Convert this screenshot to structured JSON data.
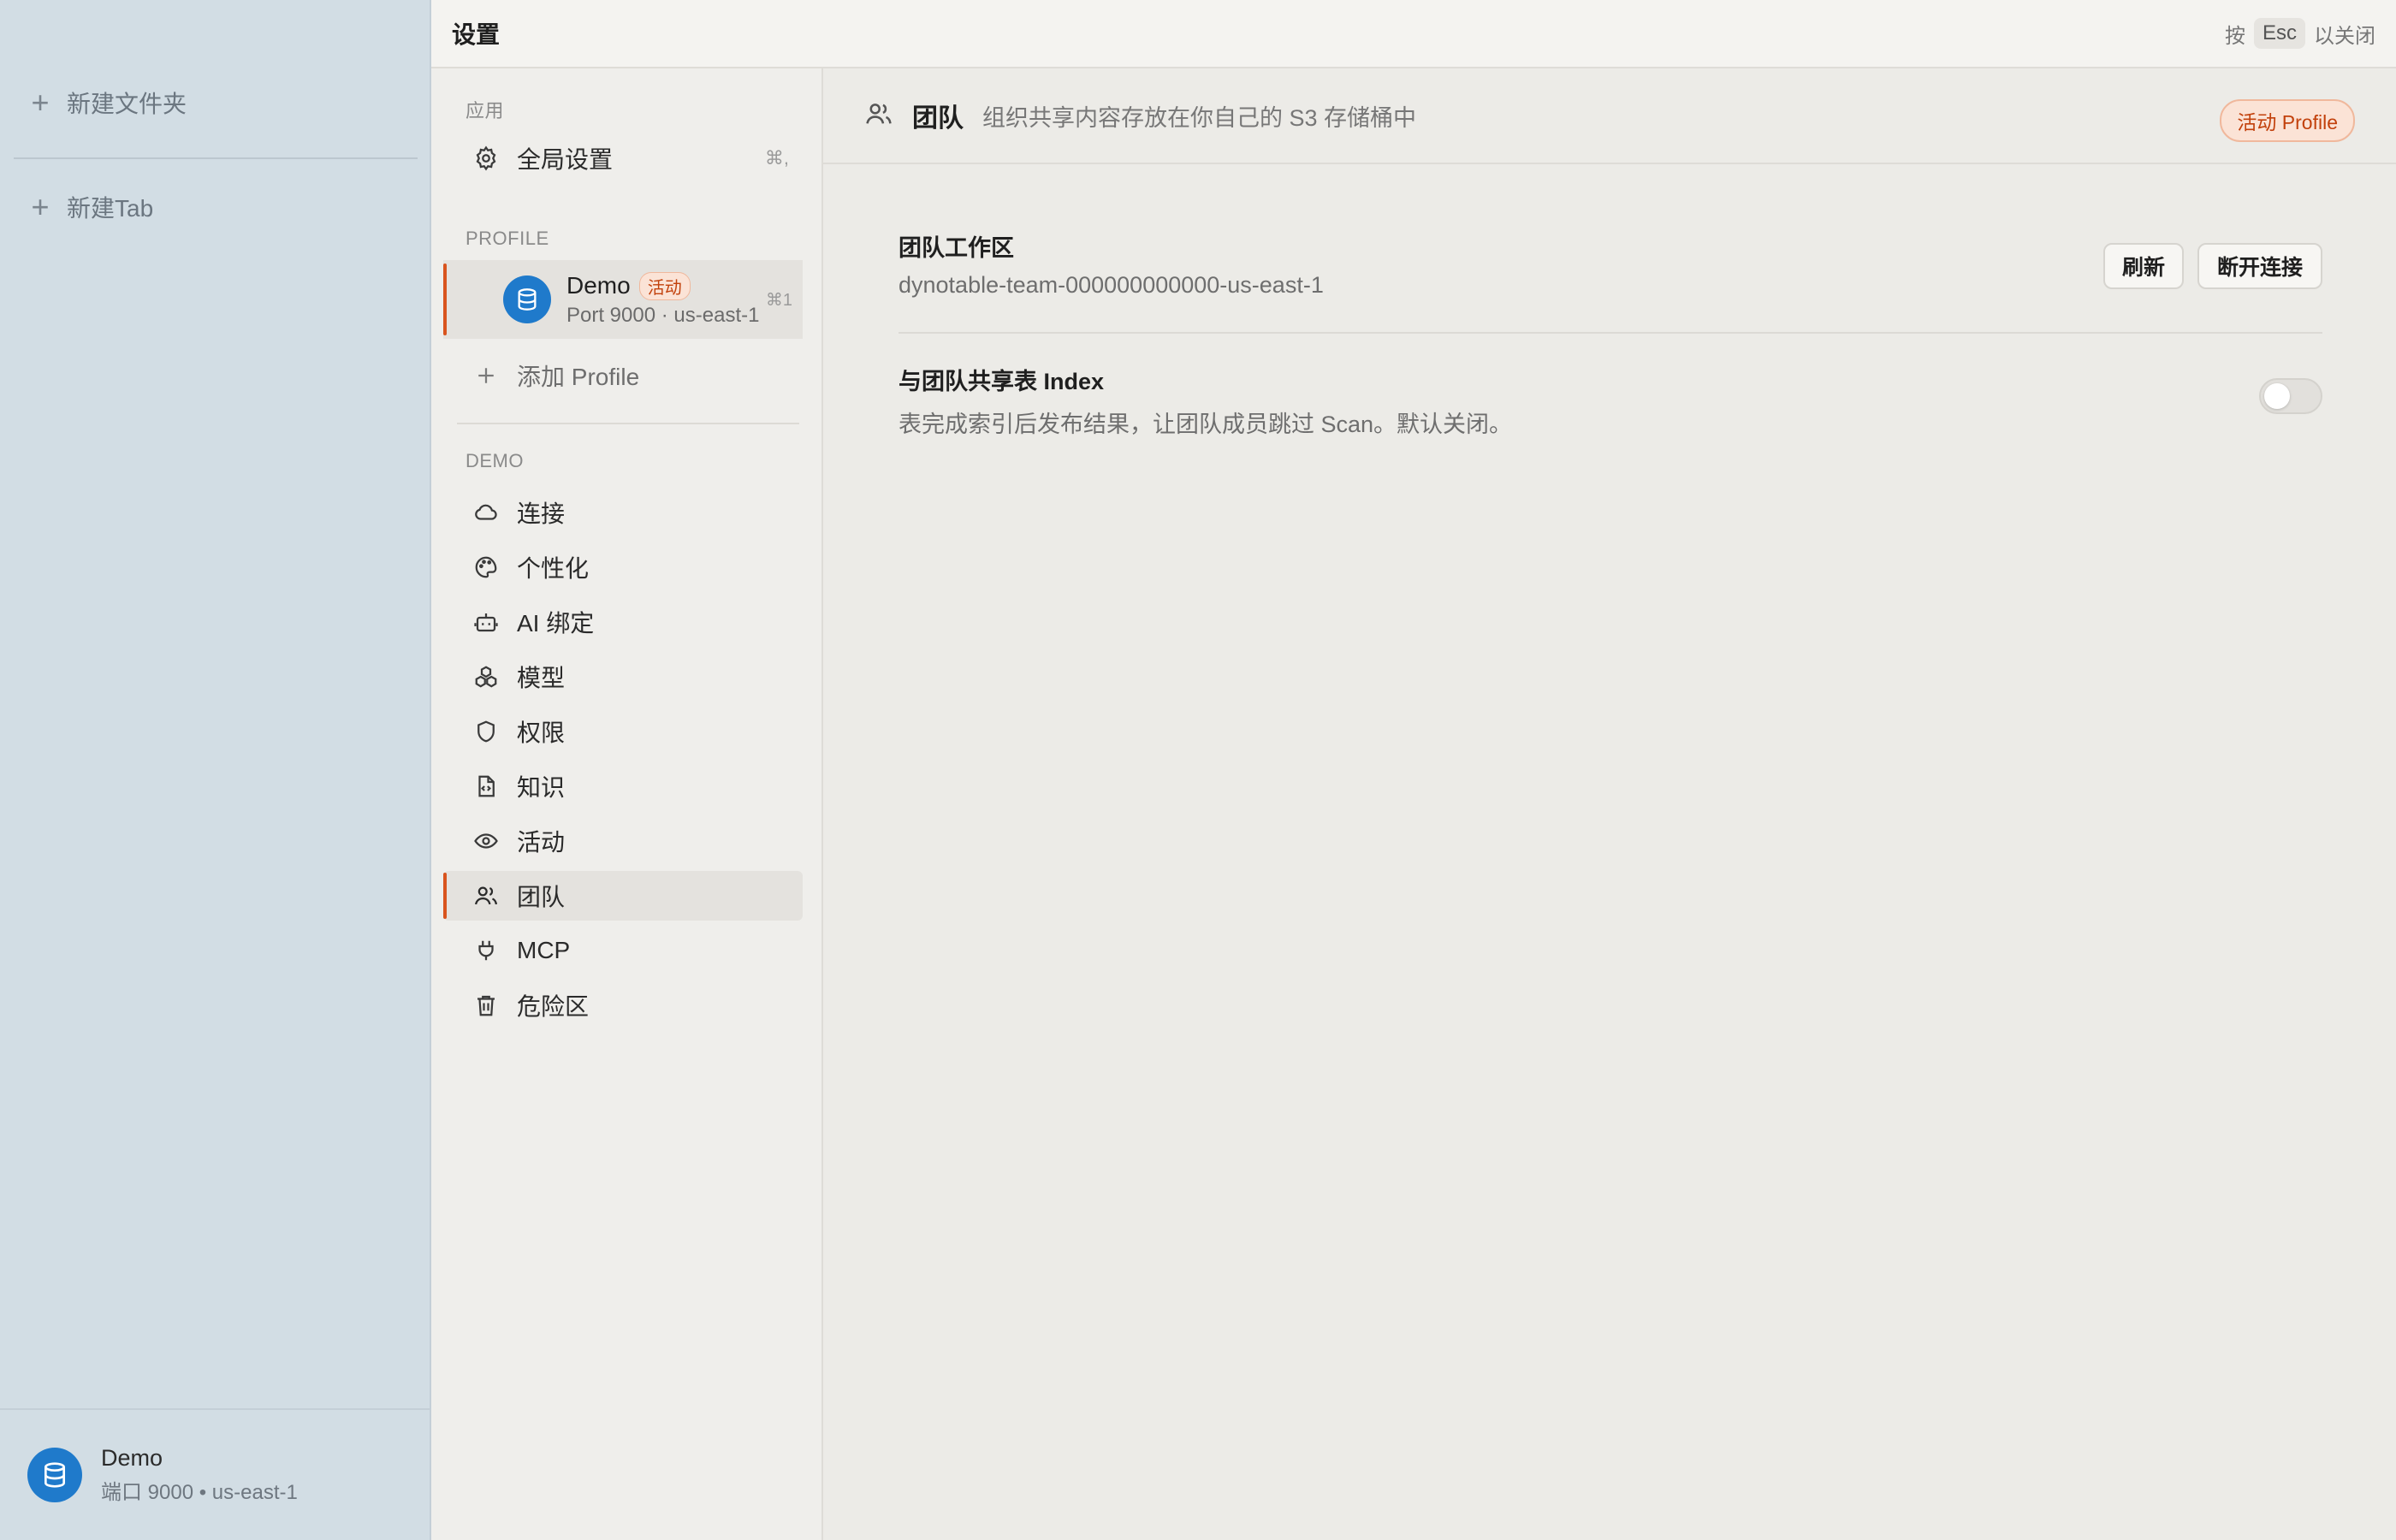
{
  "app_sidebar": {
    "new_folder_label": "新建文件夹",
    "new_tab_label": "新建Tab",
    "footer": {
      "name": "Demo",
      "subtitle": "端口 9000 • us-east-1"
    }
  },
  "topbar": {
    "title": "设置",
    "esc_prefix": "按",
    "esc_key": "Esc",
    "esc_suffix": "以关闭"
  },
  "nav": {
    "app_section": "应用",
    "global_settings": {
      "label": "全局设置",
      "shortcut": "⌘,"
    },
    "profile_section": "PROFILE",
    "profile": {
      "name": "Demo",
      "badge": "活动",
      "subtitle": "Port 9000 · us-east-1",
      "shortcut": "⌘1"
    },
    "add_profile_label": "添加 Profile",
    "demo_section": "DEMO",
    "items": [
      {
        "label": "连接",
        "icon": "cloud-icon"
      },
      {
        "label": "个性化",
        "icon": "palette-icon"
      },
      {
        "label": "AI 绑定",
        "icon": "robot-icon"
      },
      {
        "label": "模型",
        "icon": "cubes-icon"
      },
      {
        "label": "权限",
        "icon": "shield-icon"
      },
      {
        "label": "知识",
        "icon": "document-code-icon"
      },
      {
        "label": "活动",
        "icon": "eye-icon"
      },
      {
        "label": "团队",
        "icon": "users-icon",
        "active": true
      },
      {
        "label": "MCP",
        "icon": "plug-icon"
      },
      {
        "label": "危险区",
        "icon": "trash-icon"
      }
    ]
  },
  "content": {
    "title": "团队",
    "subtitle": "组织共享内容存放在你自己的 S3 存储桶中",
    "active_profile_badge": "活动 Profile",
    "workspace": {
      "title": "团队工作区",
      "value": "dynotable-team-000000000000-us-east-1",
      "refresh_label": "刷新",
      "disconnect_label": "断开连接"
    },
    "share_index": {
      "title": "与团队共享表 Index",
      "description": "表完成索引后发布结果，让团队成员跳过 Scan。默认关闭。",
      "enabled": false
    }
  },
  "colors": {
    "accent": "#d9541e",
    "avatar": "#1f7acb",
    "sidebar_bg": "#d2dde4"
  }
}
